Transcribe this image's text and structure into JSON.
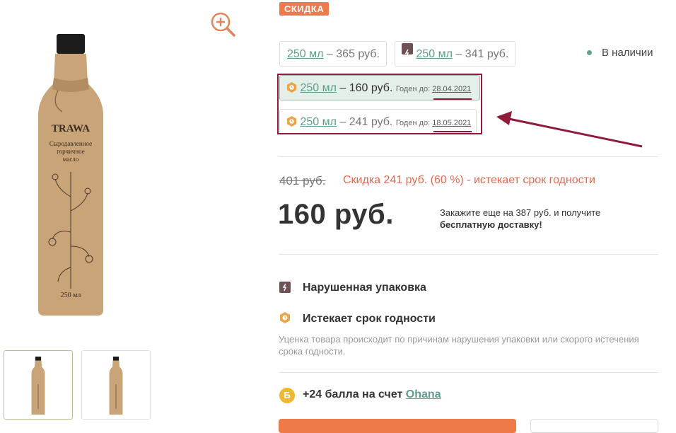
{
  "badge": {
    "sale": "СКИДКА"
  },
  "product_image": {
    "brand": "TRAWA",
    "line1": "Сыродавленное",
    "line2": "горчичное",
    "line3": "масло",
    "volume": "250 мл"
  },
  "options": [
    {
      "volume": "250 мл",
      "price": " – 365 руб.",
      "icon": "none",
      "selected": false
    },
    {
      "volume": "250 мл",
      "price": " – 341 руб.",
      "icon": "damaged-package-icon",
      "selected": false
    },
    {
      "volume": "250 мл",
      "price": " – 160 руб.",
      "icon": "expiry-clock-icon",
      "expiry_label": "Годен до: ",
      "expiry_date": "28.04.2021",
      "selected": true
    },
    {
      "volume": "250 мл",
      "price": " – 241 руб.",
      "icon": "expiry-clock-icon",
      "expiry_label": "Годен до: ",
      "expiry_date": "18.05.2021",
      "selected": false
    }
  ],
  "stock": {
    "label": "В наличии",
    "color": "#6aa08f"
  },
  "pricing": {
    "old_price": "401 руб.",
    "discount_note": "Скидка 241 руб. (60 %) - истекает срок годности",
    "current_price": "160 руб.",
    "delivery_text": "Закажите еще на 387 руб. и получите",
    "delivery_bold": "бесплатную доставку!"
  },
  "reasons": [
    {
      "label": "Нарушенная упаковка",
      "icon": "damaged-package-icon"
    },
    {
      "label": "Истекает срок годности",
      "icon": "expiry-clock-icon"
    }
  ],
  "reason_note": "Уценка товара происходит по причинам нарушения упаковки или скорого истечения срока годности.",
  "bonus": {
    "coin": "Б",
    "text": "+24 балла на счет ",
    "link": "Ohana"
  },
  "colors": {
    "accent": "#ee7a4a",
    "link": "#5a9e8a",
    "highlight": "#8e1b3a",
    "coin": "#f1b82a"
  }
}
